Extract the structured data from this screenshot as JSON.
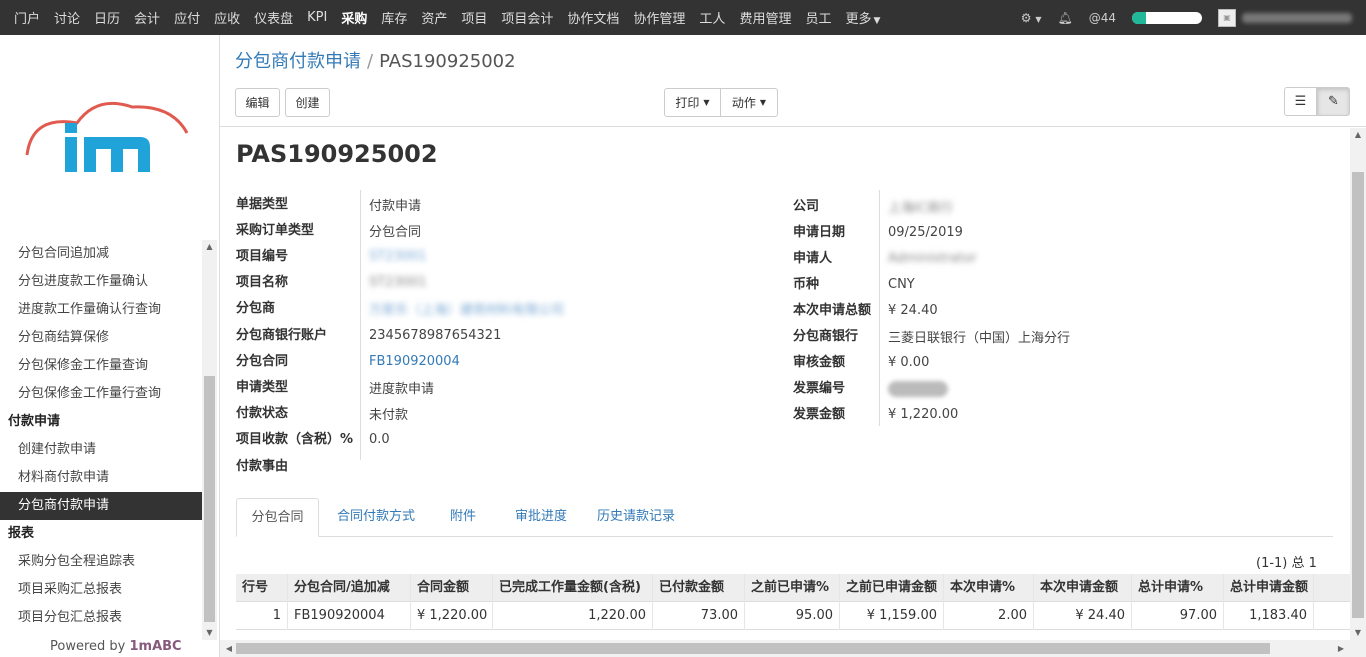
{
  "topbar": {
    "menu": [
      "门户",
      "讨论",
      "日历",
      "会计",
      "应付",
      "应收",
      "仪表盘",
      "KPI",
      "采购",
      "库存",
      "资产",
      "项目",
      "项目会计",
      "协作文档",
      "协作管理",
      "工人",
      "费用管理",
      "员工"
    ],
    "active": "采购",
    "more_label": "更多",
    "mentions": "@44",
    "progress": 0.2
  },
  "sidebar": {
    "items": [
      {
        "label": "分包合同追加减",
        "type": "item"
      },
      {
        "label": "分包进度款工作量确认",
        "type": "item"
      },
      {
        "label": "进度款工作量确认行查询",
        "type": "item"
      },
      {
        "label": "分包商结算保修",
        "type": "item"
      },
      {
        "label": "分包保修金工作量查询",
        "type": "item"
      },
      {
        "label": "分包保修金工作量行查询",
        "type": "item"
      },
      {
        "label": "付款申请",
        "type": "group"
      },
      {
        "label": "创建付款申请",
        "type": "item"
      },
      {
        "label": "材料商付款申请",
        "type": "item"
      },
      {
        "label": "分包商付款申请",
        "type": "active"
      },
      {
        "label": "报表",
        "type": "group"
      },
      {
        "label": "采购分包全程追踪表",
        "type": "item"
      },
      {
        "label": "项目采购汇总报表",
        "type": "item"
      },
      {
        "label": "项目分包汇总报表",
        "type": "item"
      }
    ],
    "powered_prefix": "Powered by ",
    "powered_brand": "1mABC"
  },
  "breadcrumb": {
    "parent": "分包商付款申请",
    "current": "PAS190925002"
  },
  "buttons": {
    "edit": "编辑",
    "create": "创建",
    "print": "打印",
    "action": "动作"
  },
  "form": {
    "title": "PAS190925002",
    "left": [
      {
        "label": "单据类型",
        "value": "付款申请",
        "style": "plain"
      },
      {
        "label": "采购订单类型",
        "value": "分包合同",
        "style": "plain"
      },
      {
        "label": "项目编号",
        "value": "ST23001",
        "style": "blurlink"
      },
      {
        "label": "项目名称",
        "value": "ST23001",
        "style": "blurgray"
      },
      {
        "label": "分包商",
        "value": "万家乐（上海）建筑材料有限公司",
        "style": "blurlink"
      },
      {
        "label": "分包商银行账户",
        "value": "2345678987654321",
        "style": "plain"
      },
      {
        "label": "分包合同",
        "value": "FB190920004",
        "style": "link"
      },
      {
        "label": "申请类型",
        "value": "进度款申请",
        "style": "plain"
      },
      {
        "label": "付款状态",
        "value": "未付款",
        "style": "plain"
      },
      {
        "label": "项目收款（含税）%",
        "value": "0.0",
        "style": "plain"
      },
      {
        "label": "付款事由",
        "value": "",
        "style": "plain"
      }
    ],
    "right": [
      {
        "label": "公司",
        "value": "上海IC商行",
        "style": "blurgray"
      },
      {
        "label": "申请日期",
        "value": "09/25/2019",
        "style": "plain"
      },
      {
        "label": "申请人",
        "value": "Administrator",
        "style": "blurgray"
      },
      {
        "label": "币种",
        "value": "CNY",
        "style": "plain"
      },
      {
        "label": "本次申请总额",
        "value": "¥ 24.40",
        "style": "plain"
      },
      {
        "label": "分包商银行",
        "value": "三菱日联银行（中国）上海分行",
        "style": "plain"
      },
      {
        "label": "审核金额",
        "value": "¥ 0.00",
        "style": "plain"
      },
      {
        "label": "发票编号",
        "value": "",
        "style": "pill"
      },
      {
        "label": "发票金额",
        "value": "¥ 1,220.00",
        "style": "plain"
      }
    ]
  },
  "tabs": [
    "分包合同",
    "合同付款方式",
    "附件",
    "审批进度",
    "历史请款记录"
  ],
  "pager": "(1-1) 总 1",
  "table": {
    "columns": [
      "行号",
      "分包合同/追加减",
      "合同金额",
      "已完成工作量金额(含税)",
      "已付款金额",
      "之前已申请%",
      "之前已申请金额",
      "本次申请%",
      "本次申请金额",
      "总计申请%",
      "总计申请金额"
    ],
    "rows": [
      [
        "1",
        "FB190920004",
        "¥ 1,220.00",
        "1,220.00",
        "73.00",
        "95.00",
        "¥ 1,159.00",
        "2.00",
        "¥ 24.40",
        "97.00",
        "1,183.40"
      ]
    ]
  }
}
